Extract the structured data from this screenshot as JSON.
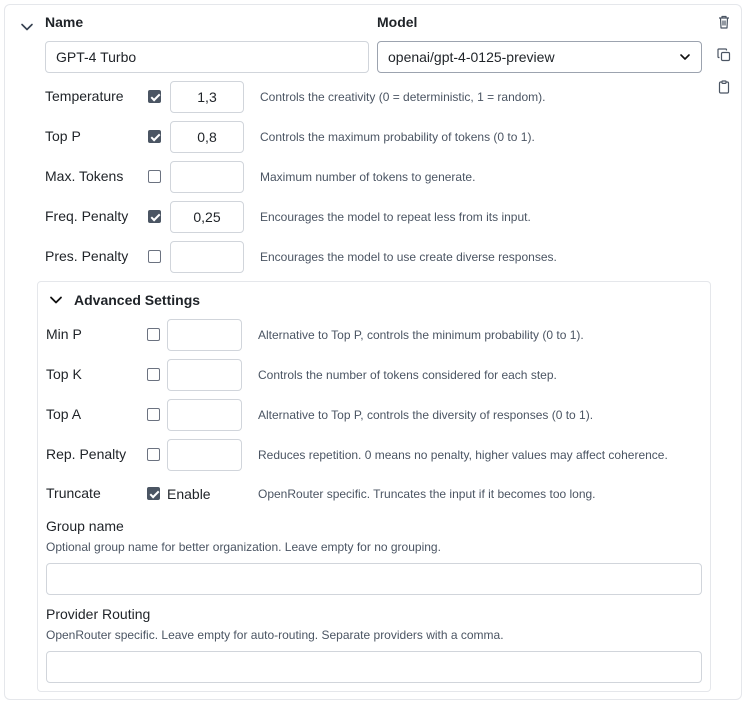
{
  "header": {
    "name_label": "Name",
    "model_label": "Model",
    "name_value": "GPT-4 Turbo",
    "model_value": "openai/gpt-4-0125-preview"
  },
  "params": [
    {
      "label": "Temperature",
      "checked": true,
      "value": "1,3",
      "desc": "Controls the creativity (0 = deterministic, 1 = random)."
    },
    {
      "label": "Top P",
      "checked": true,
      "value": "0,8",
      "desc": "Controls the maximum probability of tokens (0 to 1)."
    },
    {
      "label": "Max. Tokens",
      "checked": false,
      "value": "",
      "desc": "Maximum number of tokens to generate."
    },
    {
      "label": "Freq. Penalty",
      "checked": true,
      "value": "0,25",
      "desc": "Encourages the model to repeat less from its input."
    },
    {
      "label": "Pres. Penalty",
      "checked": false,
      "value": "",
      "desc": "Encourages the model to use create diverse responses."
    }
  ],
  "advanced": {
    "title": "Advanced Settings",
    "params": [
      {
        "label": "Min P",
        "checked": false,
        "value": "",
        "desc": "Alternative to Top P, controls the minimum probability (0 to 1)."
      },
      {
        "label": "Top K",
        "checked": false,
        "value": "",
        "desc": "Controls the number of tokens considered for each step."
      },
      {
        "label": "Top A",
        "checked": false,
        "value": "",
        "desc": "Alternative to Top P, controls the diversity of responses (0 to 1)."
      },
      {
        "label": "Rep. Penalty",
        "checked": false,
        "value": "",
        "desc": "Reduces repetition. 0 means no penalty, higher values may affect coherence."
      }
    ],
    "truncate": {
      "label": "Truncate",
      "checked": true,
      "enable_label": "Enable",
      "desc": "OpenRouter specific. Truncates the input if it becomes too long."
    },
    "group_name": {
      "label": "Group name",
      "desc": "Optional group name for better organization. Leave empty for no grouping.",
      "value": ""
    },
    "provider_routing": {
      "label": "Provider Routing",
      "desc": "OpenRouter specific. Leave empty for auto-routing. Separate providers with a comma.",
      "value": ""
    }
  },
  "icons": {
    "collapse": "chevron-down-icon",
    "delete": "trash-icon",
    "copy": "copy-icon",
    "paste": "clipboard-icon"
  }
}
